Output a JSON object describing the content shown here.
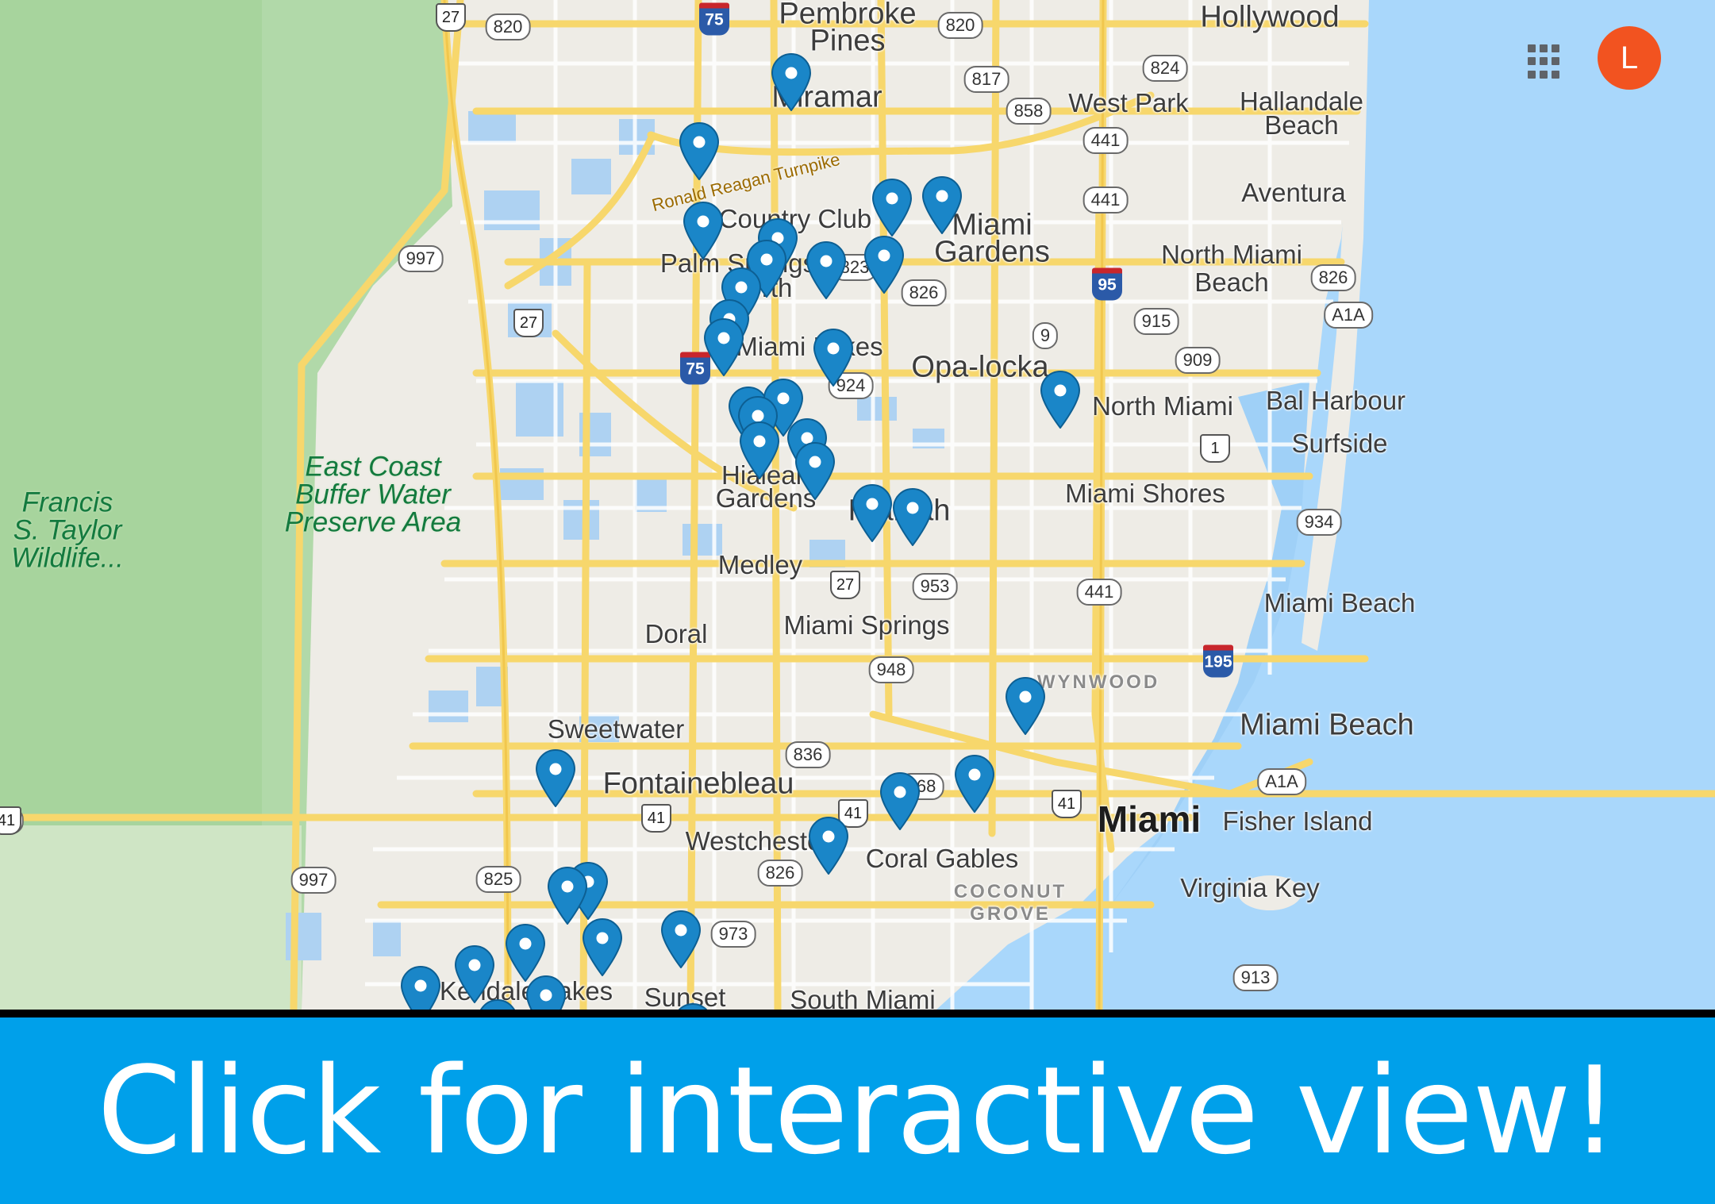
{
  "colors": {
    "ocean": "#a9d7fb",
    "everglades": "#b1d9a9",
    "land": "#eeece6",
    "lake": "#aed2f2",
    "highway": "#f7d76c",
    "pin": "#1a86c8",
    "banner": "#00a0ea",
    "avatar": "#f25320"
  },
  "map": {
    "city_labels": [
      {
        "text": "Pembroke",
        "size": "l"
      },
      {
        "text": "Pines",
        "size": "l"
      },
      {
        "text": "Hollywood",
        "size": "l"
      },
      {
        "text": "Miramar",
        "size": "l"
      },
      {
        "text": "West Park",
        "size": "m"
      },
      {
        "text": "Hallandale",
        "size": "m"
      },
      {
        "text": "Beach",
        "size": "m"
      },
      {
        "text": "Aventura",
        "size": "m"
      },
      {
        "text": "Country Club",
        "size": "m"
      },
      {
        "text": "Miami",
        "size": "l"
      },
      {
        "text": "Gardens",
        "size": "l"
      },
      {
        "text": "Palm Springs",
        "size": "m"
      },
      {
        "text": "North",
        "size": "m"
      },
      {
        "text": "North Miami",
        "size": "m"
      },
      {
        "text": "Beach",
        "size": "m"
      },
      {
        "text": "Miami Lakes",
        "size": "m"
      },
      {
        "text": "Opa-locka",
        "size": "l"
      },
      {
        "text": "North Miami",
        "size": "m"
      },
      {
        "text": "Bal Harbour",
        "size": "m"
      },
      {
        "text": "Surfside",
        "size": "m"
      },
      {
        "text": "Hialeah",
        "size": "m"
      },
      {
        "text": "Gardens",
        "size": "m"
      },
      {
        "text": "Hialeah",
        "size": "l"
      },
      {
        "text": "Miami Shores",
        "size": "m"
      },
      {
        "text": "Medley",
        "size": "m"
      },
      {
        "text": "Doral",
        "size": "m"
      },
      {
        "text": "Miami Springs",
        "size": "m"
      },
      {
        "text": "Miami Beach",
        "size": "m"
      },
      {
        "text": "Sweetwater",
        "size": "m"
      },
      {
        "text": "Miami Beach",
        "size": "l"
      },
      {
        "text": "Fontainebleau",
        "size": "l"
      },
      {
        "text": "Westchester",
        "size": "m"
      },
      {
        "text": "Coral Gables",
        "size": "m"
      },
      {
        "text": "Miami",
        "size": "xl"
      },
      {
        "text": "Fisher Island",
        "size": "m"
      },
      {
        "text": "Virginia Key",
        "size": "m"
      },
      {
        "text": "Kendale Lakes",
        "size": "m"
      },
      {
        "text": "Sunset",
        "size": "m"
      },
      {
        "text": "South Miami",
        "size": "m"
      }
    ],
    "park_labels": [
      {
        "text": "East Coast\nBuffer Water\nPreserve Area"
      },
      {
        "text": "Francis\nS. Taylor\nWildlife..."
      }
    ],
    "neighborhood_labels": [
      {
        "text": "WYNWOOD"
      },
      {
        "text": "COCONUT\nGROVE"
      }
    ],
    "road_name": "Ronald Reagan Turnpike",
    "state_routes": [
      "820",
      "820",
      "817",
      "824",
      "858",
      "441",
      "441",
      "997",
      "823",
      "826",
      "826",
      "915",
      "909",
      "A1A",
      "924",
      "9",
      "934",
      "953",
      "948",
      "441",
      "836",
      "968",
      "825",
      "997",
      "826",
      "973",
      "913",
      "A1A",
      "41"
    ],
    "interstates": [
      "75",
      "95",
      "75",
      "195"
    ],
    "us_routes": [
      "27",
      "27",
      "27",
      "41",
      "41",
      "1",
      "41",
      "41"
    ],
    "store_pins": 41
  },
  "header": {
    "apps_icon": "apps-grid-icon",
    "avatar_initial": "L"
  },
  "cta": {
    "label": "Click for interactive view!"
  }
}
